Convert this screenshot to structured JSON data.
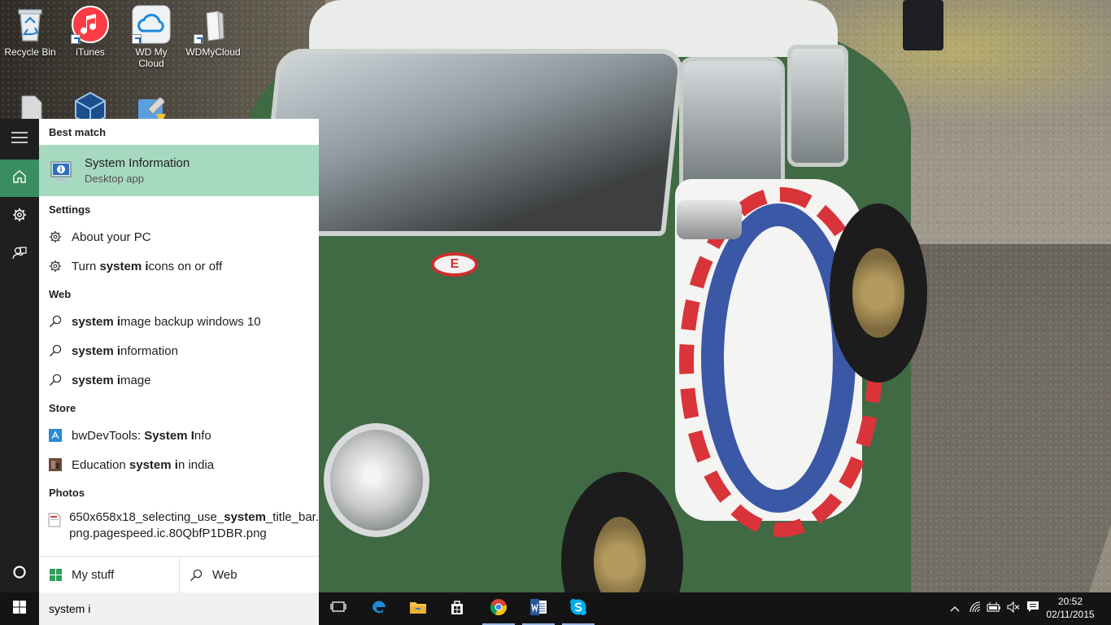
{
  "desktop": {
    "icons": [
      {
        "label": "Recycle Bin",
        "icon": "recycle-bin-icon"
      },
      {
        "label": "iTunes",
        "icon": "itunes-icon"
      },
      {
        "label": "WD My Cloud",
        "icon": "wd-my-cloud-icon"
      },
      {
        "label": "WDMyCloud",
        "icon": "wd-drive-icon"
      }
    ],
    "partial_icons": [
      "file-icon",
      "virtualbox-icon",
      "setup-tool-icon"
    ],
    "wallpaper_badge": "E"
  },
  "start_rail": {
    "items": [
      {
        "icon": "hamburger-menu-icon"
      },
      {
        "icon": "home-icon",
        "active": true
      },
      {
        "icon": "gear-icon"
      },
      {
        "icon": "feedback-icon"
      }
    ],
    "cortana_icon": "cortana-circle-icon"
  },
  "search_panel": {
    "best_match_header": "Best match",
    "best_match": {
      "title_bold": "System I",
      "title_rest": "nformation",
      "subtitle": "Desktop app",
      "icon": "system-information-icon"
    },
    "settings_header": "Settings",
    "settings": [
      {
        "pre": "About your PC",
        "bold": "",
        "post": "",
        "icon": "gear-icon"
      },
      {
        "pre": "Turn ",
        "bold": "system i",
        "post": "cons on or off",
        "icon": "gear-icon"
      }
    ],
    "web_header": "Web",
    "web": [
      {
        "bold": "system i",
        "post": "mage backup windows 10",
        "icon": "search-icon"
      },
      {
        "bold": "system i",
        "post": "nformation",
        "icon": "search-icon"
      },
      {
        "bold": "system i",
        "post": "mage",
        "icon": "search-icon"
      }
    ],
    "store_header": "Store",
    "store": [
      {
        "pre": "bwDevTools: ",
        "bold": "System I",
        "post": "nfo",
        "icon": "store-app-icon"
      },
      {
        "pre": "Education ",
        "bold": "system i",
        "post": "n india",
        "icon": "store-thumbnail-icon"
      }
    ],
    "photos_header": "Photos",
    "photo": {
      "line1_pre": "650x658x18_selecting_use_",
      "line1_bold": "system",
      "line1_post": "_title_bar.",
      "line2": "png.pagespeed.ic.80QbfP1DBR.png",
      "icon": "photo-file-icon"
    },
    "scope_my_stuff": "My stuff",
    "scope_web": "Web"
  },
  "taskbar": {
    "search_value": "system i",
    "apps": [
      {
        "icon": "task-view-icon",
        "running": false
      },
      {
        "icon": "edge-icon",
        "running": false
      },
      {
        "icon": "file-explorer-icon",
        "running": false
      },
      {
        "icon": "store-icon",
        "running": false
      },
      {
        "icon": "chrome-icon",
        "running": true
      },
      {
        "icon": "word-icon",
        "running": true
      },
      {
        "icon": "skype-icon",
        "running": true
      }
    ],
    "tray": [
      "show-hidden-icons-chevron-icon",
      "wifi-icon",
      "battery-icon",
      "volume-muted-icon",
      "action-center-icon"
    ],
    "time": "20:52",
    "date": "02/11/2015"
  },
  "colors": {
    "accent": "#3a8d60",
    "best_match_bg": "#a7d9c1",
    "rail_bg": "#1f1f1f",
    "taskbar_bg": "#141414"
  }
}
